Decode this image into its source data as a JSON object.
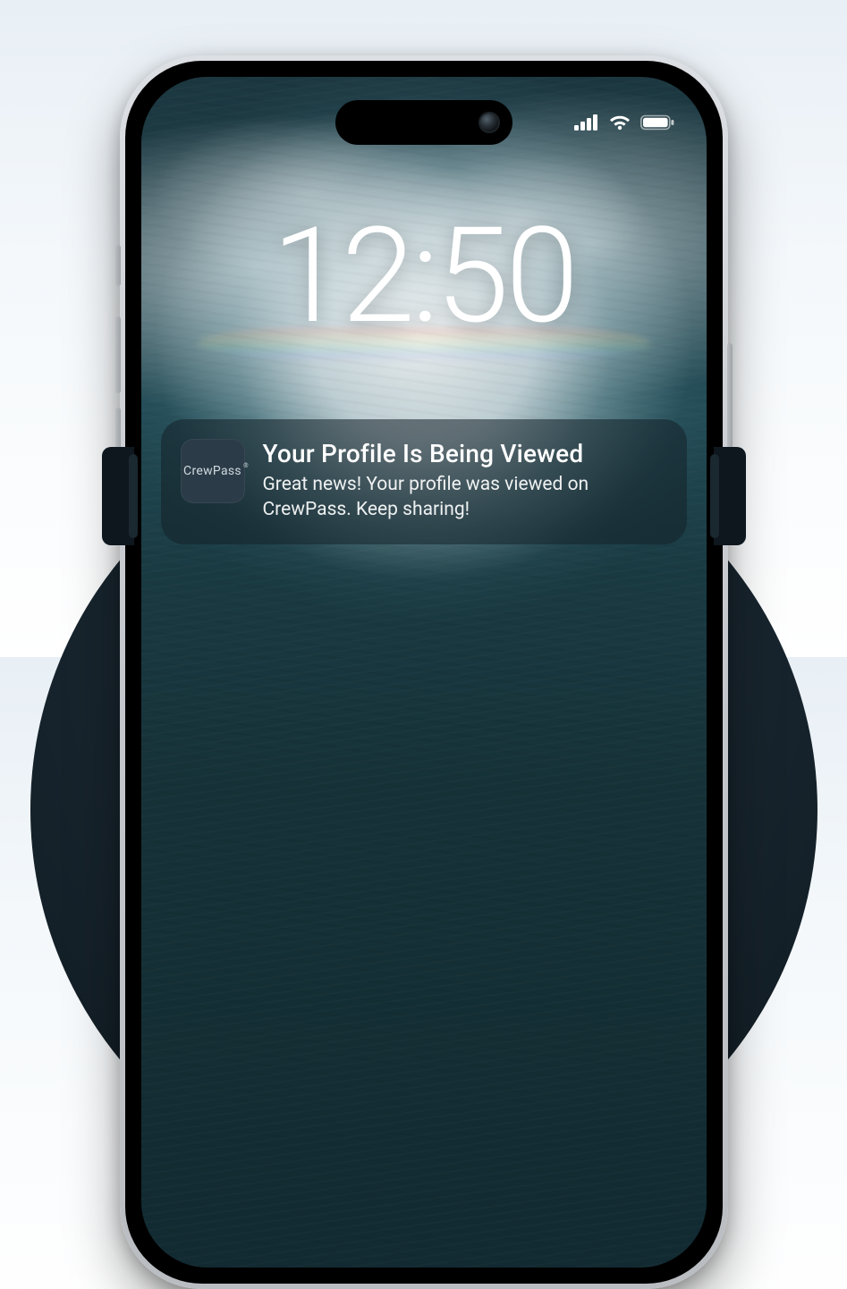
{
  "lockscreen": {
    "time": "12:50"
  },
  "notification": {
    "app_name": "CrewPass",
    "title": "Your Profile Is Being Viewed",
    "body": "Great news! Your profile was viewed on CrewPass. Keep sharing!"
  }
}
